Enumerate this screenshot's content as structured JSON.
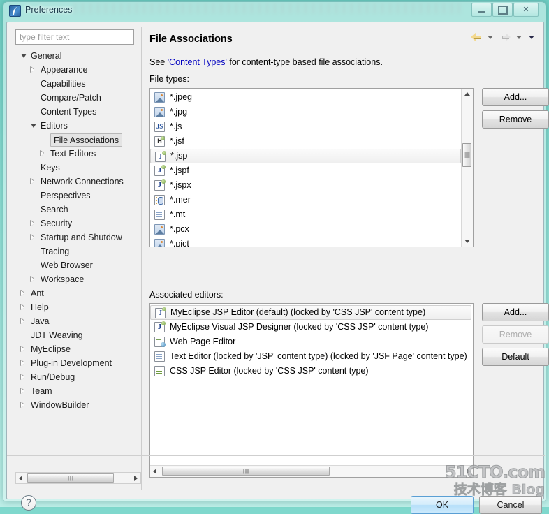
{
  "window": {
    "title": "Preferences",
    "app_icon": "eclipse-icon",
    "minimize_label": "",
    "maximize_label": "",
    "close_label": "✕"
  },
  "sidebar": {
    "filter_placeholder": "type filter text",
    "filter_value": "",
    "items": [
      {
        "label": "General",
        "depth": 0,
        "arrow": "down",
        "selected": false
      },
      {
        "label": "Appearance",
        "depth": 1,
        "arrow": "right",
        "selected": false
      },
      {
        "label": "Capabilities",
        "depth": 1,
        "arrow": "none",
        "selected": false
      },
      {
        "label": "Compare/Patch",
        "depth": 1,
        "arrow": "none",
        "selected": false
      },
      {
        "label": "Content Types",
        "depth": 1,
        "arrow": "none",
        "selected": false
      },
      {
        "label": "Editors",
        "depth": 1,
        "arrow": "down",
        "selected": false
      },
      {
        "label": "File Associations",
        "depth": 2,
        "arrow": "none",
        "selected": true
      },
      {
        "label": "Text Editors",
        "depth": 2,
        "arrow": "right",
        "selected": false
      },
      {
        "label": "Keys",
        "depth": 1,
        "arrow": "none",
        "selected": false
      },
      {
        "label": "Network Connections",
        "depth": 1,
        "arrow": "right",
        "selected": false
      },
      {
        "label": "Perspectives",
        "depth": 1,
        "arrow": "none",
        "selected": false
      },
      {
        "label": "Search",
        "depth": 1,
        "arrow": "none",
        "selected": false
      },
      {
        "label": "Security",
        "depth": 1,
        "arrow": "right",
        "selected": false
      },
      {
        "label": "Startup and Shutdow",
        "depth": 1,
        "arrow": "right",
        "selected": false
      },
      {
        "label": "Tracing",
        "depth": 1,
        "arrow": "none",
        "selected": false
      },
      {
        "label": "Web Browser",
        "depth": 1,
        "arrow": "none",
        "selected": false
      },
      {
        "label": "Workspace",
        "depth": 1,
        "arrow": "right",
        "selected": false
      },
      {
        "label": "Ant",
        "depth": 0,
        "arrow": "right",
        "selected": false
      },
      {
        "label": "Help",
        "depth": 0,
        "arrow": "right",
        "selected": false
      },
      {
        "label": "Java",
        "depth": 0,
        "arrow": "right",
        "selected": false
      },
      {
        "label": "JDT Weaving",
        "depth": 0,
        "arrow": "none",
        "selected": false
      },
      {
        "label": "MyEclipse",
        "depth": 0,
        "arrow": "right",
        "selected": false
      },
      {
        "label": "Plug-in Development",
        "depth": 0,
        "arrow": "right",
        "selected": false
      },
      {
        "label": "Run/Debug",
        "depth": 0,
        "arrow": "right",
        "selected": false
      },
      {
        "label": "Team",
        "depth": 0,
        "arrow": "right",
        "selected": false
      },
      {
        "label": "WindowBuilder",
        "depth": 0,
        "arrow": "right",
        "selected": false
      }
    ]
  },
  "page": {
    "title": "File Associations",
    "description_before": "See ",
    "description_link": "'Content Types'",
    "description_after": " for content-type based file associations.",
    "file_types_label": "File types:",
    "associated_editors_label": "Associated editors:"
  },
  "nav": {
    "back_icon": "back-arrow-icon",
    "back_menu_icon": "chevron-down-icon",
    "forward_icon": "forward-arrow-icon",
    "forward_menu_icon": "chevron-down-icon",
    "view_menu_icon": "chevron-down-icon"
  },
  "file_types": {
    "items": [
      {
        "label": "*.jpeg",
        "icon": "image-file-icon",
        "selected": false
      },
      {
        "label": "*.jpg",
        "icon": "image-file-icon",
        "selected": false
      },
      {
        "label": "*.js",
        "icon": "js-file-icon",
        "selected": false
      },
      {
        "label": "*.jsf",
        "icon": "jsf-file-icon",
        "selected": false
      },
      {
        "label": "*.jsp",
        "icon": "jsp-file-icon",
        "selected": true
      },
      {
        "label": "*.jspf",
        "icon": "jsp-file-icon",
        "selected": false
      },
      {
        "label": "*.jspx",
        "icon": "jsp-file-icon",
        "selected": false
      },
      {
        "label": "*.mer",
        "icon": "mer-file-icon",
        "selected": false
      },
      {
        "label": "*.mt",
        "icon": "text-file-icon",
        "selected": false
      },
      {
        "label": "*.pcx",
        "icon": "image-file-icon",
        "selected": false
      },
      {
        "label": "*.pict",
        "icon": "image-file-icon",
        "selected": false
      }
    ],
    "add_label": "Add...",
    "remove_label": "Remove",
    "add_enabled": true,
    "remove_enabled": true
  },
  "associated_editors": {
    "items": [
      {
        "label": "MyEclipse JSP Editor (default) (locked by 'CSS JSP' content type)",
        "icon": "jsp-file-icon",
        "selected": true
      },
      {
        "label": "MyEclipse Visual JSP Designer (locked by 'CSS JSP' content type)",
        "icon": "jsp-file-icon",
        "selected": false
      },
      {
        "label": "Web Page Editor",
        "icon": "web-page-icon",
        "selected": false
      },
      {
        "label": "Text Editor (locked by 'JSP' content type) (locked by 'JSF Page' content type)",
        "icon": "text-file-icon",
        "selected": false
      },
      {
        "label": "CSS JSP Editor (locked by 'CSS JSP' content type)",
        "icon": "css-file-icon",
        "selected": false
      }
    ],
    "add_label": "Add...",
    "remove_label": "Remove",
    "default_label": "Default",
    "add_enabled": true,
    "remove_enabled": false,
    "default_enabled": true
  },
  "footer": {
    "help_icon": "help-question-icon",
    "ok_label": "OK",
    "cancel_label": "Cancel"
  },
  "watermark": {
    "line1": "51CTO.com",
    "line2": "技术博客  Blog"
  },
  "colors": {
    "accent": "#b5dffa",
    "link": "#0000c0",
    "glass": "#8fe0d6",
    "dialog_bg": "#f0f0f0"
  }
}
